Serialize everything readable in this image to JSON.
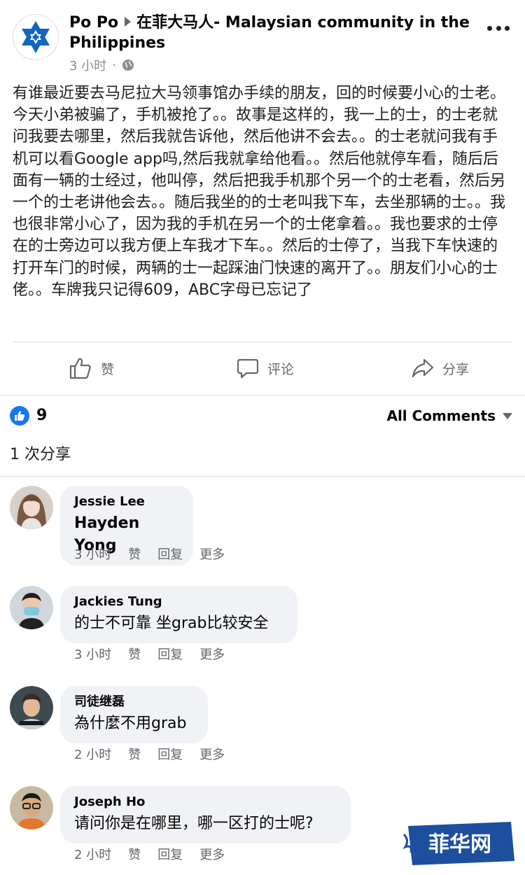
{
  "post": {
    "author": "Po Po",
    "group": "在菲大马人- Malaysian community in the Philippines",
    "time": "3 小时",
    "privacy_icon": "globe-icon",
    "text": "有谁最近要去马尼拉大马领事馆办手续的朋友，回的时候要小心的士老。今天小弟被骗了，手机被抢了。。故事是这样的，我一上的士，的士老就问我要去哪里，然后我就告诉他，然后他讲不会去。。的士老就问我有手机可以看Google app吗,然后我就拿给他看。。然后他就停车看，随后后面有一辆的士经过，他叫停，然后把我手机那个另一个的士老看，然后另一个的士老讲他会去。。随后我坐的的士老叫我下车，去坐那辆的士。。我也很非常小心了，因为我的手机在另一个的士佬拿着。。我也要求的士停在的士旁边可以我方便上车我才下车。。然后的士停了，当我下车快速的打开车门的时候，两辆的士一起踩油门快速的离开了。。朋友们小心的士佬。。车牌我只记得609，ABC字母已忘记了"
  },
  "actions": {
    "like": "赞",
    "comment": "评论",
    "share": "分享"
  },
  "reactions": {
    "count": "9",
    "filter": "All Comments"
  },
  "shares": "1 次分享",
  "comment_meta": {
    "like": "赞",
    "reply": "回复",
    "more": "更多"
  },
  "comments": [
    {
      "name": "Jessie Lee",
      "text": "Hayden Yong",
      "time": "3 小时"
    },
    {
      "name": "Jackies Tung",
      "text": "的士不可靠 坐grab比较安全",
      "time": "3 小时"
    },
    {
      "name": "司徒继磊",
      "text": "為什麼不用grab",
      "time": "2 小时"
    },
    {
      "name": "Joseph Ho",
      "text": "请问你是在哪里，哪一区打的士呢?",
      "time": "2 小时"
    }
  ],
  "watermark": "菲华网",
  "colors": {
    "accent": "#1877f2",
    "bubble": "#f0f2f5",
    "meta": "#65676b",
    "watermark_blue": "#1d4f9e"
  }
}
